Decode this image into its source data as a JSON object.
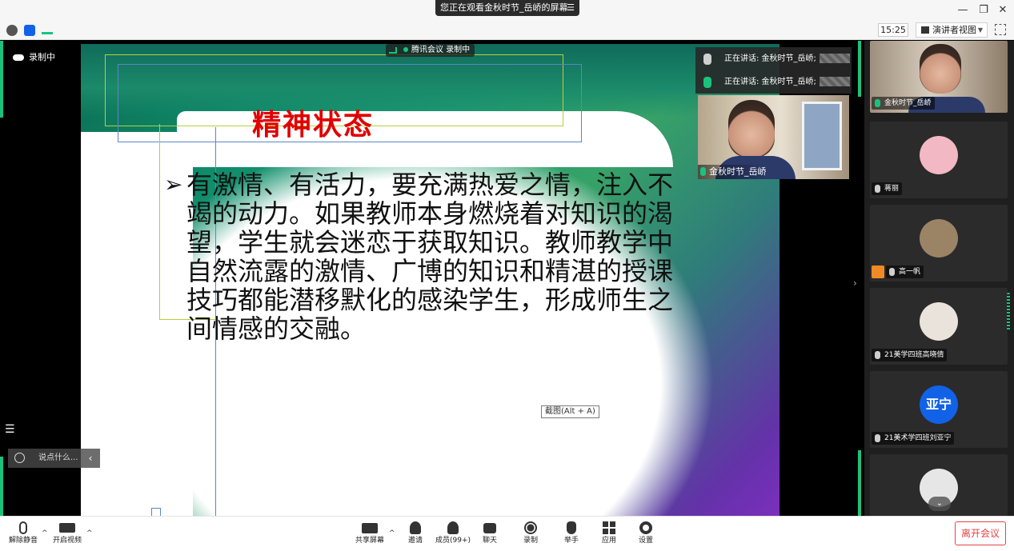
{
  "titlebar": {
    "share_text": "您正在观看金秋时节_岳峤的屏幕",
    "menu_glyph": "☰",
    "minimize": "—",
    "restore": "❐",
    "close": "✕"
  },
  "topbar": {
    "time": "15:25",
    "view_label": "演讲者视图",
    "view_caret": "▼"
  },
  "stage": {
    "recording_label": "录制中",
    "meeting_tag_text": "腾讯会议",
    "meeting_tag_recording": "录制中",
    "screenshot_hint": "截图(Alt + A)",
    "collapse_glyph": "›"
  },
  "slide": {
    "title": "精神状态",
    "bullet": "➢",
    "body": "有激情、有活力，要充满热爱之情，注入不竭的动力。如果教师本身燃烧着对知识的渴望，学生就会迷恋于获取知识。教师教学中自然流露的激情、广博的知识和精湛的授课技巧都能潜移默化的感染学生，形成师生之间情感的交融。"
  },
  "speakers": [
    {
      "text": "正在讲话: 金秋时节_岳峤;",
      "mic": "off"
    },
    {
      "text": "正在讲话: 金秋时节_岳峤;",
      "mic": "on"
    }
  ],
  "pip": {
    "name": "金秋时节_岳峤"
  },
  "chat": {
    "placeholder": "说点什么...",
    "arrow": "‹"
  },
  "participants": [
    {
      "name": "金秋时节_岳峤",
      "kind": "video",
      "mic": "on"
    },
    {
      "name": "蒋丽",
      "kind": "avatar",
      "avatar_color": "#f2b8c3",
      "mic": "off"
    },
    {
      "name": "高一帆",
      "kind": "avatar",
      "avatar_color": "#9b8466",
      "mic": "off",
      "badge": true
    },
    {
      "name": "21美学四班高晓倩",
      "kind": "avatar",
      "avatar_color": "#e9e3dc",
      "mic": "off"
    },
    {
      "name": "21美术学四班刘亚宁",
      "kind": "initials",
      "initials": "亚宁",
      "mic": "off"
    },
    {
      "name": "",
      "kind": "avatar",
      "avatar_color": "#e6e6e6",
      "mic": "off"
    }
  ],
  "participants_chevron": "⌄",
  "toolbar": {
    "unmute": "解除静音",
    "start_video": "开启视频",
    "share_screen": "共享屏幕",
    "invite": "邀请",
    "members": "成员(99+)",
    "chat": "聊天",
    "record": "录制",
    "raise_hand": "举手",
    "apps": "应用",
    "settings": "设置",
    "leave": "离开会议",
    "caret": "^"
  },
  "colors": {
    "accent_green": "#19c37d",
    "leave_red": "#e54545",
    "title_red": "#e00000",
    "avatar_blue": "#1262e8"
  }
}
